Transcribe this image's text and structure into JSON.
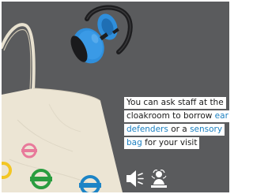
{
  "caption": {
    "line1": "You can ask staff at the",
    "line2_prefix": "cloakroom to borrow ",
    "line2_highlight": "ear",
    "line3_highlight": "defenders",
    "line3_middle": " or a ",
    "line3_highlight_end": "sensory",
    "line4_highlight": "bag",
    "line4_suffix": " for your visit"
  },
  "icons": {
    "loud_sound": "loud-sound-icon",
    "sensory_person": "sensory-person-icon"
  },
  "colors": {
    "background": "#58595b",
    "highlight_text": "#1b7fc0",
    "ear_defender_blue": "#2f8fdc",
    "bag_fabric": "#ece5d4"
  }
}
